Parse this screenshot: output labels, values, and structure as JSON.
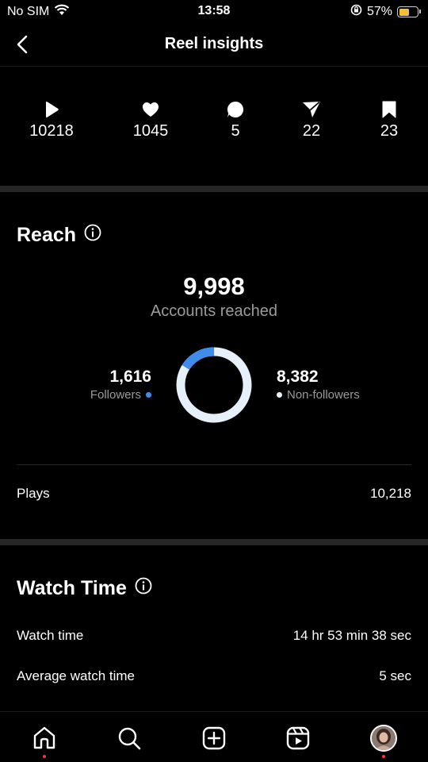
{
  "status": {
    "carrier": "No SIM",
    "time": "13:58",
    "battery": "57%",
    "battery_level": 0.57
  },
  "header": {
    "title": "Reel insights"
  },
  "metrics": [
    {
      "icon": "play-icon",
      "value": "10218"
    },
    {
      "icon": "heart-icon",
      "value": "1045"
    },
    {
      "icon": "comment-icon",
      "value": "5"
    },
    {
      "icon": "share-icon",
      "value": "22"
    },
    {
      "icon": "bookmark-icon",
      "value": "23"
    }
  ],
  "reach": {
    "title": "Reach",
    "accounts_reached": "9,998",
    "accounts_reached_label": "Accounts reached",
    "followers_value": "1,616",
    "followers_label": "Followers",
    "non_followers_value": "8,382",
    "non_followers_label": "Non-followers",
    "followers_fraction": 0.1616,
    "colors": {
      "followers": "#3f8ceb",
      "non_followers": "#e6f0fb"
    },
    "plays_label": "Plays",
    "plays_value": "10,218"
  },
  "watch_time": {
    "title": "Watch Time",
    "rows": [
      {
        "label": "Watch time",
        "value": "14 hr 53 min 38 sec"
      },
      {
        "label": "Average watch time",
        "value": "5 sec"
      }
    ]
  },
  "tabs": [
    {
      "icon": "home-icon"
    },
    {
      "icon": "search-icon"
    },
    {
      "icon": "new-post-icon"
    },
    {
      "icon": "reels-icon"
    },
    {
      "icon": "profile-avatar"
    }
  ]
}
